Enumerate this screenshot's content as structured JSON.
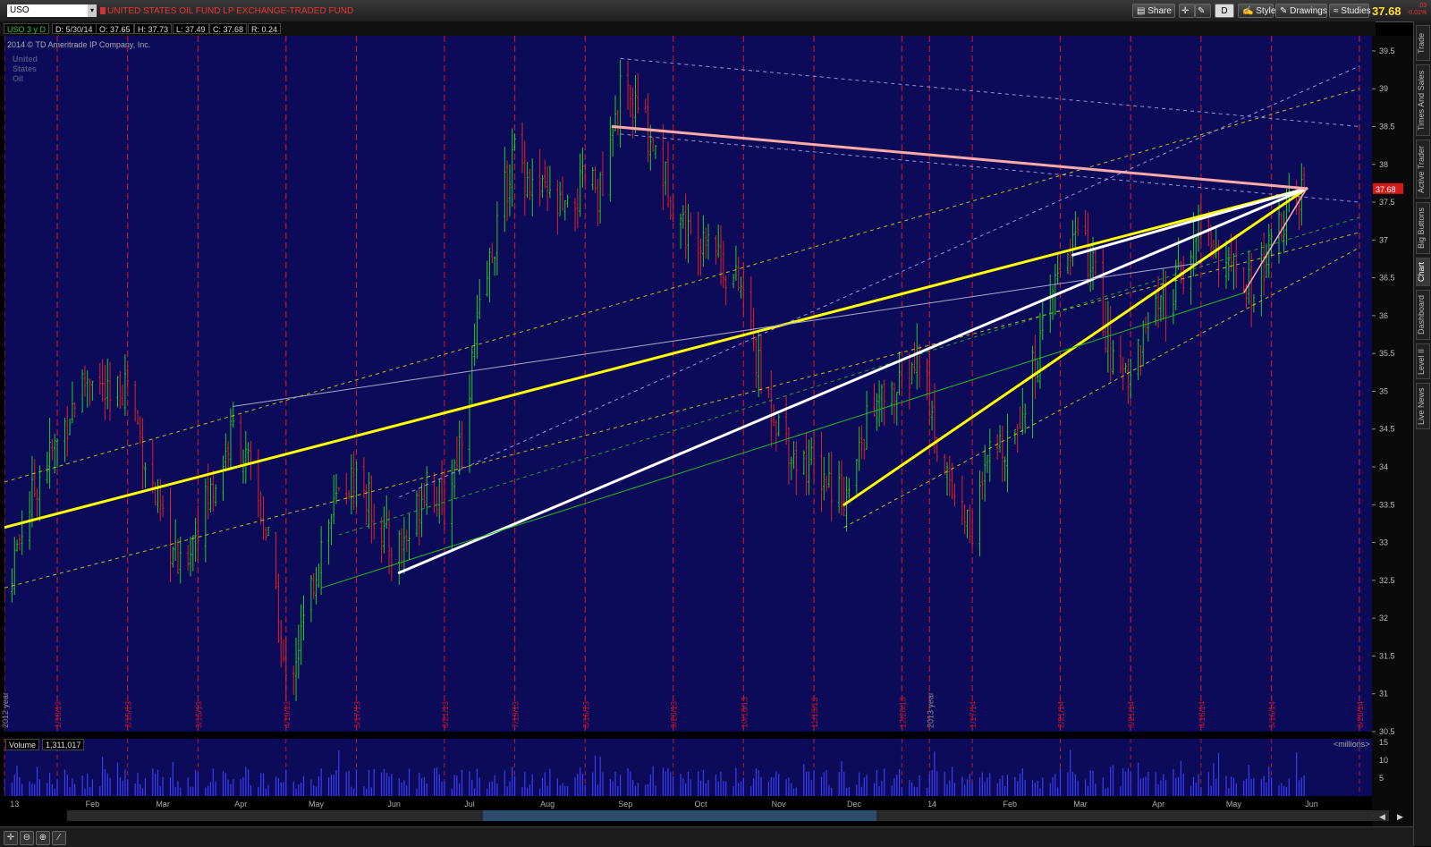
{
  "header": {
    "symbol": "USO",
    "fund_name": "UNITED STATES OIL FUND LP EXCHANGE-TRADED FUND",
    "buttons": {
      "share": "Share",
      "style": "Style",
      "drawings": "Drawings",
      "studies": "Studies",
      "aggregation": "D"
    },
    "last_price": "37.68",
    "change": ".03",
    "change_pct": "-0.01%"
  },
  "infobar": {
    "period": "USO 3 y D",
    "date": "D: 5/30/14",
    "open": "O: 37.65",
    "high": "H: 37.73",
    "low": "L: 37.49",
    "close": "C: 37.68",
    "range": "R: 0.24"
  },
  "copyright": "2014 © TD Ameritrade IP Company, Inc.",
  "watermark": [
    "United",
    "States",
    "Oil"
  ],
  "sidebar": [
    "Trade",
    "Times And Sales",
    "Active Trader",
    "Big Buttons",
    "Chart",
    "Dashboard",
    "Level II",
    "Live News"
  ],
  "volume": {
    "label": "Volume",
    "value": "1,311,017",
    "units": "<millions>",
    "ticks": [
      "15",
      "10",
      "5"
    ]
  },
  "chart_data": {
    "type": "candlestick",
    "ylim": [
      30.5,
      39.7
    ],
    "yticks": [
      30.5,
      31,
      31.5,
      32,
      32.5,
      33,
      33.5,
      34,
      34.5,
      35,
      35.5,
      36,
      36.5,
      37,
      37.5,
      38,
      38.5,
      39,
      39.5
    ],
    "last_price_label": "37.68",
    "xlim": [
      "2012-12-28",
      "2014-06-25"
    ],
    "week_markers": [
      "2012 year",
      "1/18/13",
      "2/15/13",
      "3/15/13",
      "4/19/13",
      "5/17/13",
      "6/21/13",
      "7/19/13",
      "8/16/13",
      "9/20/13",
      "10/18/13",
      "11/15/13",
      "12/20/13",
      "2013 year",
      "1/17/14",
      "2/21/14",
      "3/21/14",
      "4/18/14",
      "5/16/14",
      "6/20/14"
    ],
    "month_labels": [
      "13",
      "Feb",
      "Mar",
      "Apr",
      "May",
      "Jun",
      "Jul",
      "Aug",
      "Sep",
      "Oct",
      "Nov",
      "Dec",
      "14",
      "Feb",
      "Mar",
      "Apr",
      "May",
      "Jun"
    ],
    "price_path": [
      [
        "2012-12-28",
        32.3
      ],
      [
        "2013-01-04",
        33.2
      ],
      [
        "2013-01-11",
        33.9
      ],
      [
        "2013-01-18",
        34.3
      ],
      [
        "2013-01-25",
        34.9
      ],
      [
        "2013-02-01",
        35.3
      ],
      [
        "2013-02-08",
        34.8
      ],
      [
        "2013-02-15",
        35.2
      ],
      [
        "2013-02-22",
        34.1
      ],
      [
        "2013-03-01",
        33.2
      ],
      [
        "2013-03-08",
        32.6
      ],
      [
        "2013-03-15",
        33.3
      ],
      [
        "2013-03-22",
        33.8
      ],
      [
        "2013-03-29",
        34.5
      ],
      [
        "2013-04-05",
        33.9
      ],
      [
        "2013-04-12",
        33.0
      ],
      [
        "2013-04-19",
        31.1
      ],
      [
        "2013-04-26",
        31.9
      ],
      [
        "2013-05-03",
        33.0
      ],
      [
        "2013-05-10",
        33.6
      ],
      [
        "2013-05-17",
        33.9
      ],
      [
        "2013-05-24",
        33.4
      ],
      [
        "2013-05-31",
        32.9
      ],
      [
        "2013-06-07",
        33.1
      ],
      [
        "2013-06-14",
        33.9
      ],
      [
        "2013-06-21",
        33.4
      ],
      [
        "2013-06-28",
        34.5
      ],
      [
        "2013-07-05",
        36.0
      ],
      [
        "2013-07-12",
        37.2
      ],
      [
        "2013-07-19",
        38.2
      ],
      [
        "2013-07-26",
        37.7
      ],
      [
        "2013-08-02",
        37.5
      ],
      [
        "2013-08-09",
        37.3
      ],
      [
        "2013-08-16",
        37.8
      ],
      [
        "2013-08-23",
        37.6
      ],
      [
        "2013-08-30",
        38.9
      ],
      [
        "2013-09-06",
        38.7
      ],
      [
        "2013-09-13",
        38.2
      ],
      [
        "2013-09-20",
        37.5
      ],
      [
        "2013-09-27",
        37.0
      ],
      [
        "2013-10-04",
        37.2
      ],
      [
        "2013-10-11",
        36.6
      ],
      [
        "2013-10-18",
        36.3
      ],
      [
        "2013-10-25",
        35.1
      ],
      [
        "2013-11-01",
        34.6
      ],
      [
        "2013-11-08",
        34.1
      ],
      [
        "2013-11-15",
        34.0
      ],
      [
        "2013-11-22",
        33.8
      ],
      [
        "2013-11-29",
        33.6
      ],
      [
        "2013-12-06",
        34.6
      ],
      [
        "2013-12-13",
        34.9
      ],
      [
        "2013-12-20",
        35.0
      ],
      [
        "2013-12-27",
        35.5
      ],
      [
        "2014-01-03",
        34.3
      ],
      [
        "2014-01-10",
        33.6
      ],
      [
        "2014-01-17",
        33.2
      ],
      [
        "2014-01-24",
        34.1
      ],
      [
        "2014-01-31",
        34.4
      ],
      [
        "2014-02-07",
        34.9
      ],
      [
        "2014-02-14",
        35.7
      ],
      [
        "2014-02-21",
        36.7
      ],
      [
        "2014-02-28",
        37.1
      ],
      [
        "2014-03-07",
        36.5
      ],
      [
        "2014-03-14",
        35.3
      ],
      [
        "2014-03-21",
        35.3
      ],
      [
        "2014-03-28",
        35.9
      ],
      [
        "2014-04-04",
        36.1
      ],
      [
        "2014-04-11",
        36.6
      ],
      [
        "2014-04-18",
        37.3
      ],
      [
        "2014-04-25",
        36.8
      ],
      [
        "2014-05-02",
        36.5
      ],
      [
        "2014-05-09",
        36.3
      ],
      [
        "2014-05-16",
        36.9
      ],
      [
        "2014-05-23",
        37.4
      ],
      [
        "2014-05-30",
        37.68
      ]
    ],
    "drawings": [
      {
        "color": "#ffff00",
        "width": 3,
        "from": [
          "2012-12-28",
          33.2
        ],
        "to": [
          "2014-05-30",
          37.68
        ]
      },
      {
        "color": "#ffff00",
        "width": 3,
        "from": [
          "2013-11-27",
          33.5
        ],
        "to": [
          "2014-05-30",
          37.68
        ]
      },
      {
        "color": "#ffffff",
        "width": 3,
        "from": [
          "2013-06-03",
          32.6
        ],
        "to": [
          "2014-05-30",
          37.68
        ]
      },
      {
        "color": "#ffffff",
        "width": 3,
        "from": [
          "2014-02-26",
          36.8
        ],
        "to": [
          "2014-05-30",
          37.68
        ]
      },
      {
        "color": "#ffaaaa",
        "width": 3,
        "from": [
          "2013-08-27",
          38.5
        ],
        "to": [
          "2014-05-30",
          37.68
        ]
      },
      {
        "color": "#ffaaaa",
        "width": 1.5,
        "from": [
          "2014-05-05",
          36.3
        ],
        "to": [
          "2014-05-30",
          37.68
        ]
      },
      {
        "color": "#aaaacc",
        "width": 1,
        "from": [
          "2013-03-29",
          34.8
        ],
        "to": [
          "2014-04-18",
          36.7
        ]
      },
      {
        "color": "#22bb22",
        "width": 1,
        "from": [
          "2013-05-03",
          32.4
        ],
        "to": [
          "2014-05-05",
          36.3
        ]
      }
    ],
    "channels": [
      {
        "color": "#dddd00",
        "from": [
          "2012-12-28",
          33.8
        ],
        "to": [
          "2014-06-20",
          39.0
        ]
      },
      {
        "color": "#dddd00",
        "from": [
          "2012-12-28",
          32.4
        ],
        "to": [
          "2014-06-20",
          37.1
        ]
      },
      {
        "color": "#dddd00",
        "from": [
          "2013-11-27",
          33.2
        ],
        "to": [
          "2014-06-20",
          36.9
        ]
      },
      {
        "color": "#aaaaee",
        "from": [
          "2013-06-03",
          33.6
        ],
        "to": [
          "2014-06-20",
          39.3
        ]
      },
      {
        "color": "#aaaaee",
        "from": [
          "2013-08-30",
          39.4
        ],
        "to": [
          "2014-06-20",
          38.5
        ]
      },
      {
        "color": "#aaaaee",
        "from": [
          "2013-08-30",
          38.4
        ],
        "to": [
          "2014-06-20",
          37.5
        ]
      },
      {
        "color": "#22bb22",
        "from": [
          "2013-05-10",
          33.1
        ],
        "to": [
          "2014-06-20",
          37.3
        ]
      }
    ]
  }
}
